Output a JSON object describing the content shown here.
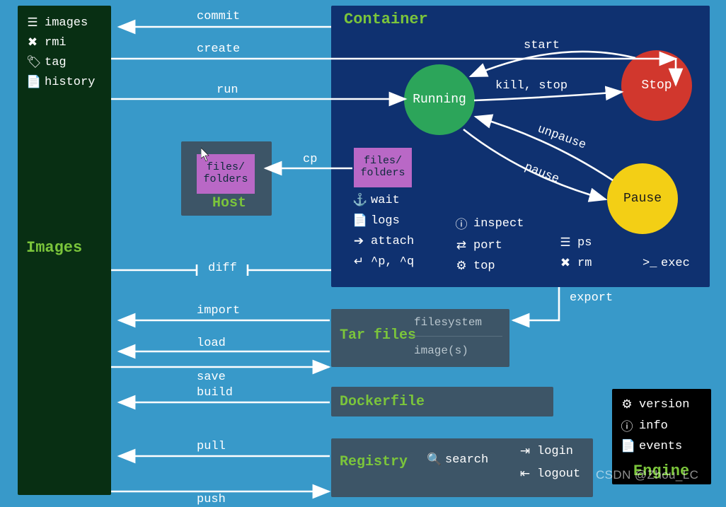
{
  "images_panel": {
    "title": "Images",
    "commands": [
      {
        "icon": "☰",
        "label": "images"
      },
      {
        "icon": "✖",
        "label": "rmi"
      },
      {
        "icon": "🏷",
        "label": "tag"
      },
      {
        "icon": "📄",
        "label": "history"
      }
    ]
  },
  "container_panel": {
    "title": "Container",
    "states": {
      "running": "Running",
      "stop": "Stop",
      "pause": "Pause"
    },
    "files_folders": "files/\nfolders",
    "commands_col1": [
      {
        "icon": "⚓",
        "label": "wait"
      },
      {
        "icon": "📄",
        "label": "logs"
      },
      {
        "icon": "➔",
        "label": "attach"
      },
      {
        "icon": "↵",
        "label": "^p, ^q"
      }
    ],
    "commands_col2": [
      {
        "icon": "ⓘ",
        "label": "inspect"
      },
      {
        "icon": "⇄",
        "label": "port"
      },
      {
        "icon": "⚙",
        "label": "top"
      }
    ],
    "commands_col3": [
      {
        "icon": "☰",
        "label": "ps"
      },
      {
        "icon": "✖",
        "label": "rm"
      }
    ],
    "exec": {
      "icon": ">_",
      "label": "exec"
    }
  },
  "host_panel": {
    "title": "Host",
    "files_folders": "files/\nfolders"
  },
  "tar_panel": {
    "title": "Tar files",
    "sub1": "filesystem",
    "sub2": "image(s)"
  },
  "dockerfile_panel": {
    "title": "Dockerfile"
  },
  "registry_panel": {
    "title": "Registry",
    "search": {
      "icon": "🔍",
      "label": "search"
    },
    "login": {
      "icon": "⇥",
      "label": "login"
    },
    "logout": {
      "icon": "⇤",
      "label": "logout"
    }
  },
  "engine_panel": {
    "title": "Engine",
    "commands": [
      {
        "icon": "⚙",
        "label": "version"
      },
      {
        "icon": "ⓘ",
        "label": "info"
      },
      {
        "icon": "📄",
        "label": "events"
      }
    ]
  },
  "arrows": {
    "commit": "commit",
    "create": "create",
    "run": "run",
    "cp": "cp",
    "diff": "diff",
    "import": "import",
    "load": "load",
    "save": "save",
    "build": "build",
    "pull": "pull",
    "push": "push",
    "export": "export",
    "start": "start",
    "killstop": "kill, stop",
    "unpause": "unpause",
    "pause": "pause"
  },
  "watermark": "CSDN @Zhou_LC"
}
